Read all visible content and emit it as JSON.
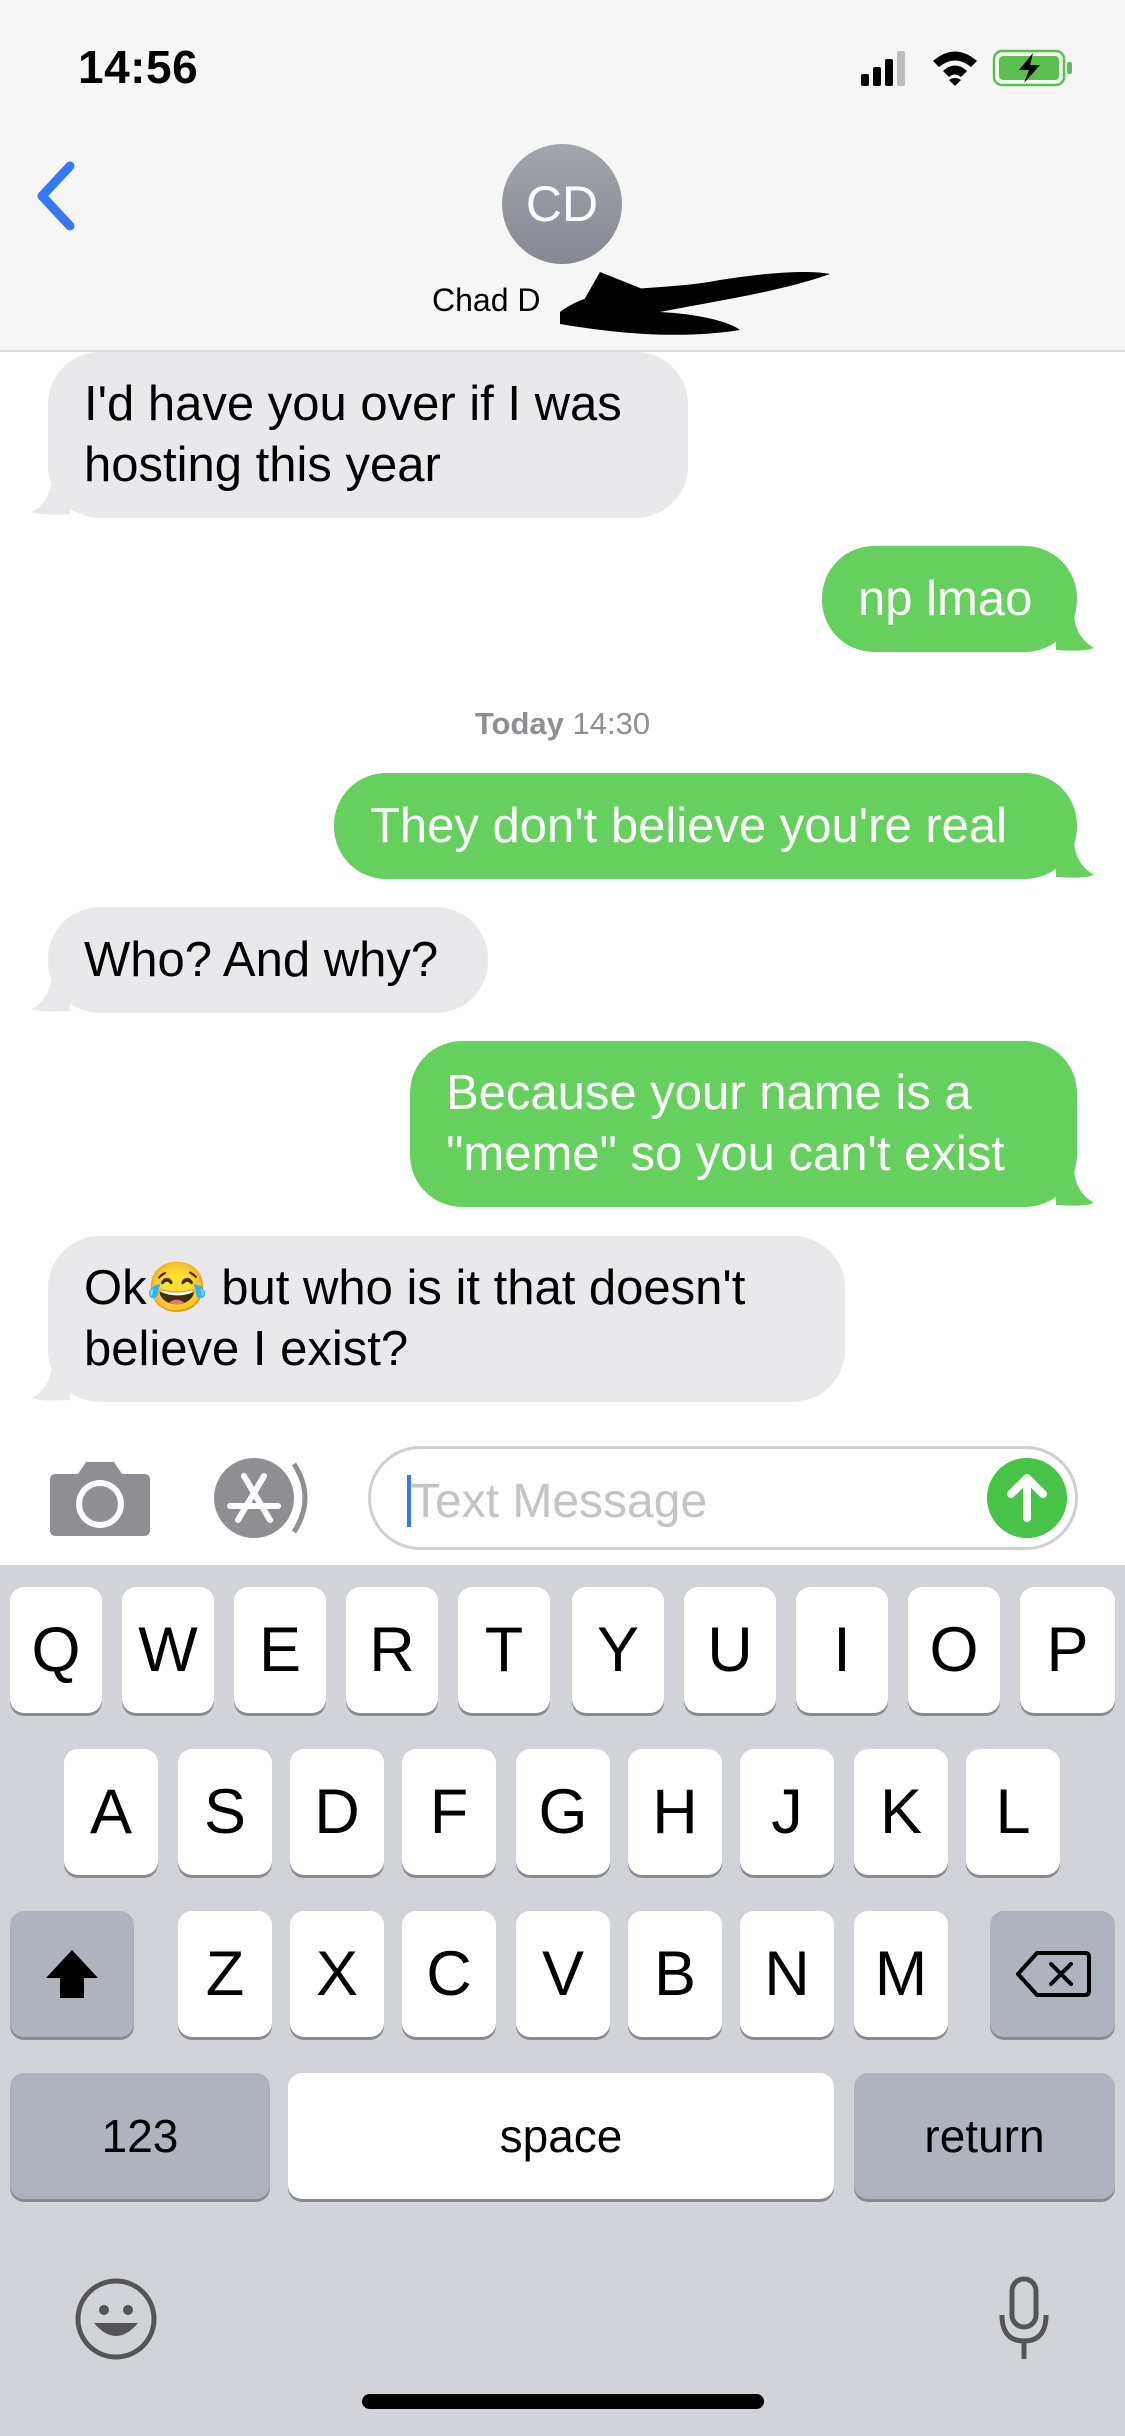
{
  "status_bar": {
    "time": "14:56"
  },
  "header": {
    "avatar_initials": "CD",
    "contact_name": "Chad D"
  },
  "messages": [
    {
      "direction": "received",
      "text": "I'd have you over if I was hosting this year"
    },
    {
      "direction": "sent",
      "text": "np lmao"
    },
    {
      "direction": "sent",
      "text": "They don't believe you're real"
    },
    {
      "direction": "received",
      "text": "Who? And why?"
    },
    {
      "direction": "sent",
      "text": "Because your name is a \"meme\" so you can't exist"
    },
    {
      "direction": "received",
      "text": "Ok😂 but who is it that doesn't believe I exist?"
    }
  ],
  "timestamp": {
    "day": "Today",
    "time": "14:30"
  },
  "input": {
    "placeholder": "Text Message"
  },
  "keyboard": {
    "row1": [
      "Q",
      "W",
      "E",
      "R",
      "T",
      "Y",
      "U",
      "I",
      "O",
      "P"
    ],
    "row2": [
      "A",
      "S",
      "D",
      "F",
      "G",
      "H",
      "J",
      "K",
      "L"
    ],
    "row3": [
      "Z",
      "X",
      "C",
      "V",
      "B",
      "N",
      "M"
    ],
    "numbers_label": "123",
    "space_label": "space",
    "return_label": "return"
  },
  "colors": {
    "sent_bubble": "#65d05e",
    "received_bubble": "#e9e9eb",
    "accent_blue": "#3478f6",
    "keyboard_bg": "#d1d3d9"
  },
  "icons": [
    "back-chevron-icon",
    "camera-icon",
    "app-store-icon",
    "send-arrow-icon",
    "shift-icon",
    "delete-icon",
    "emoji-icon",
    "microphone-icon",
    "signal-icon",
    "wifi-icon",
    "battery-charging-icon"
  ]
}
